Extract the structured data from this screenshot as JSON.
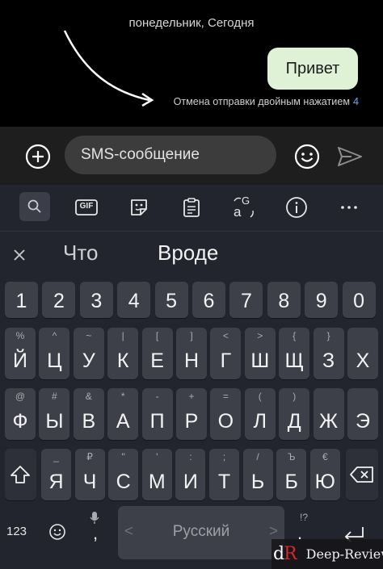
{
  "chat": {
    "date_label": "понедельник, Сегодня",
    "message_text": "Привет",
    "undo_hint": "Отмена отправки двойным нажатием",
    "undo_countdown": "4"
  },
  "composer": {
    "input_placeholder": "SMS-сообщение",
    "icons": [
      "add-icon",
      "emoji-icon",
      "send-icon"
    ]
  },
  "keyboard": {
    "toolbar_icons": [
      "search-icon",
      "gif-icon",
      "sticker-icon",
      "clipboard-icon",
      "translate-icon",
      "info-icon",
      "more-icon"
    ],
    "gif_label": "GIF",
    "translate_glyph_top": "G",
    "translate_glyph_bottom": "a",
    "suggestions": [
      "Что",
      "Вроде"
    ],
    "number_row": [
      "1",
      "2",
      "3",
      "4",
      "5",
      "6",
      "7",
      "8",
      "9",
      "0"
    ],
    "row1": {
      "keys": [
        "Й",
        "Ц",
        "У",
        "К",
        "Е",
        "Н",
        "Г",
        "Ш",
        "Щ",
        "З",
        "Х"
      ],
      "hints": [
        "%",
        "^",
        "~",
        "|",
        "[",
        "]",
        "<",
        ">",
        "{",
        "}",
        ""
      ]
    },
    "row2": {
      "keys": [
        "Ф",
        "Ы",
        "В",
        "А",
        "П",
        "Р",
        "О",
        "Л",
        "Д",
        "Ж",
        "Э"
      ],
      "hints": [
        "@",
        "#",
        "&",
        "*",
        "-",
        "+",
        "=",
        "(",
        ")",
        "",
        ""
      ]
    },
    "row3": {
      "keys": [
        "Я",
        "Ч",
        "С",
        "М",
        "И",
        "Т",
        "Ь",
        "Б",
        "Ю"
      ],
      "hints": [
        "_",
        "₽",
        "\"",
        "'",
        ":",
        ";",
        "/",
        "Ъ",
        "€"
      ]
    },
    "bottom": {
      "numeric_toggle": "123",
      "comma": ",",
      "space_language": "Русский",
      "space_left_arrow": "<",
      "space_right_arrow": ">",
      "period": ".",
      "period_hint": "!?"
    },
    "colors": {
      "background": "#23252e",
      "key": "#3e4049",
      "bubble": "#dff2d6",
      "accent": "#6ea8ff"
    }
  },
  "watermark": {
    "logo_d": "d",
    "logo_r": "R",
    "text": "Deep-Review"
  }
}
